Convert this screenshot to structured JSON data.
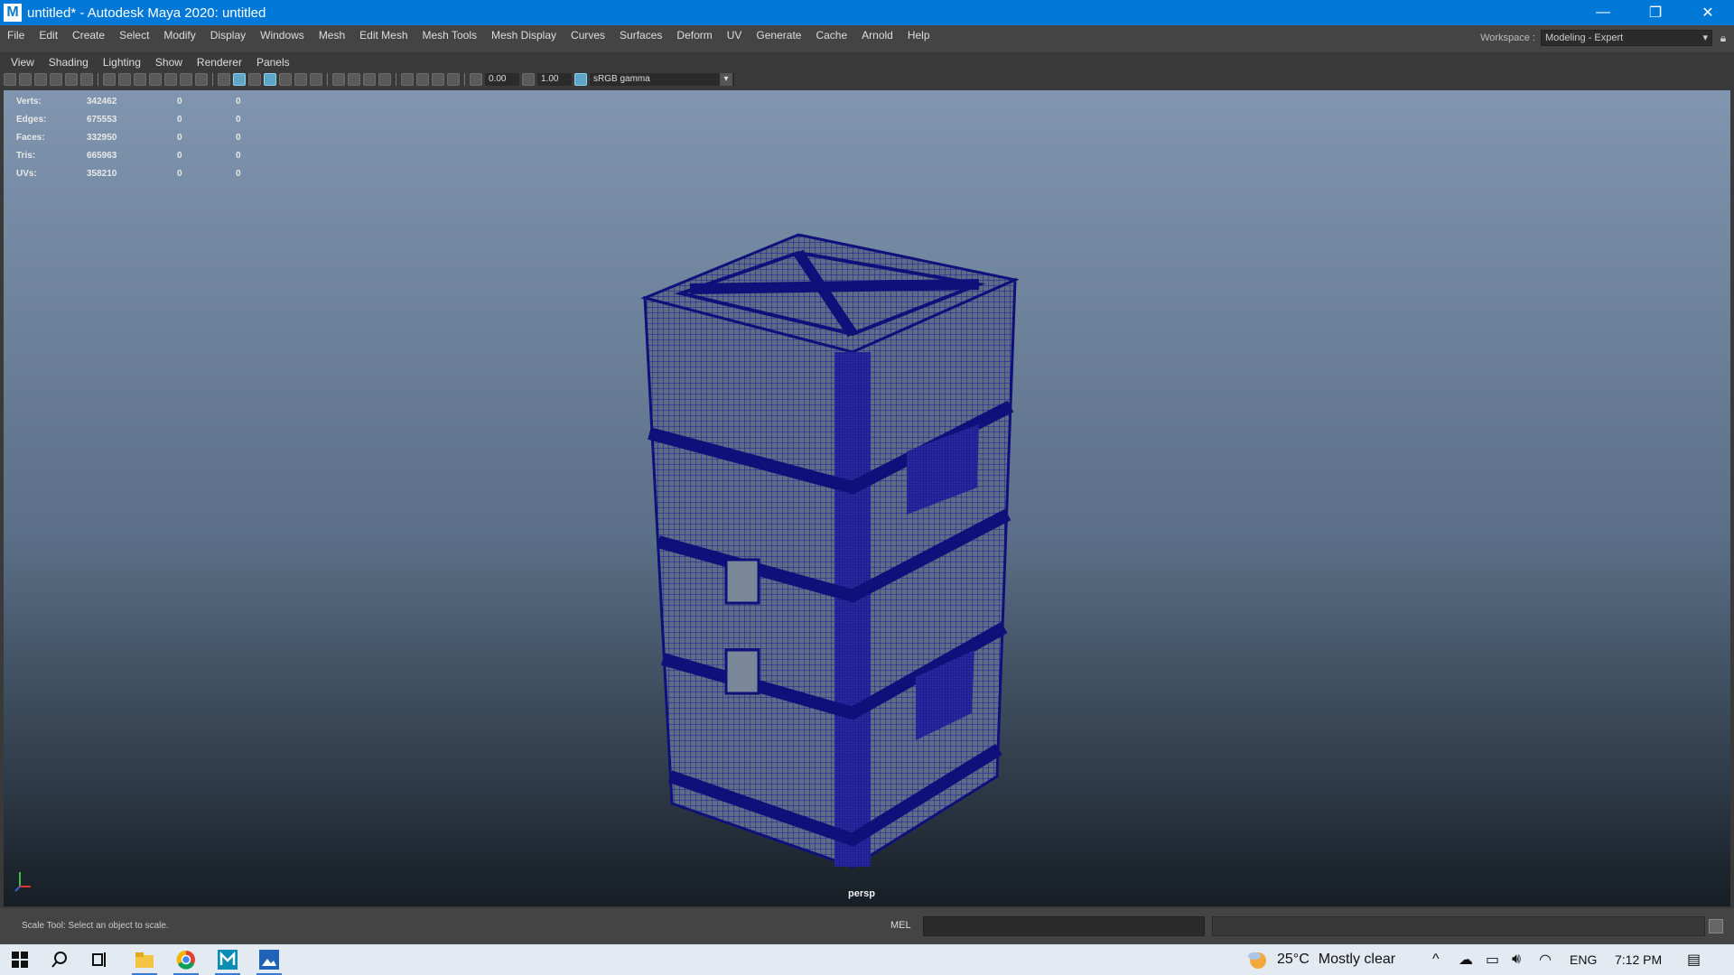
{
  "window": {
    "title": "untitled* - Autodesk Maya 2020: untitled",
    "app_icon": "M",
    "controls": {
      "minimize": "—",
      "restore": "❐",
      "close": "✕"
    }
  },
  "menubar": {
    "items": [
      "File",
      "Edit",
      "Create",
      "Select",
      "Modify",
      "Display",
      "Windows",
      "Mesh",
      "Edit Mesh",
      "Mesh Tools",
      "Mesh Display",
      "Curves",
      "Surfaces",
      "Deform",
      "UV",
      "Generate",
      "Cache",
      "Arnold",
      "Help"
    ],
    "workspace_label": "Workspace :",
    "workspace_value": "Modeling - Expert"
  },
  "panel": {
    "menu": [
      "View",
      "Shading",
      "Lighting",
      "Show",
      "Renderer",
      "Panels"
    ],
    "exposure": "0.00",
    "gamma": "1.00",
    "color_space": "sRGB gamma"
  },
  "hud": {
    "rows": [
      {
        "label": "Verts:",
        "v1": "342462",
        "v2": "0",
        "v3": "0"
      },
      {
        "label": "Edges:",
        "v1": "675553",
        "v2": "0",
        "v3": "0"
      },
      {
        "label": "Faces:",
        "v1": "332950",
        "v2": "0",
        "v3": "0"
      },
      {
        "label": "Tris:",
        "v1": "665963",
        "v2": "0",
        "v3": "0"
      },
      {
        "label": "UVs:",
        "v1": "358210",
        "v2": "0",
        "v3": "0"
      }
    ]
  },
  "viewport": {
    "camera": "persp",
    "background_top": "#8095af",
    "background_bottom": "#161d24",
    "wireframe_color": "#1a1a9e"
  },
  "statusline": {
    "help": "Scale Tool: Select an object to scale.",
    "lang": "MEL"
  },
  "taskbar": {
    "weather_temp": "25°C",
    "weather_text": "Mostly clear",
    "lang": "ENG",
    "time": "7:12 PM"
  }
}
